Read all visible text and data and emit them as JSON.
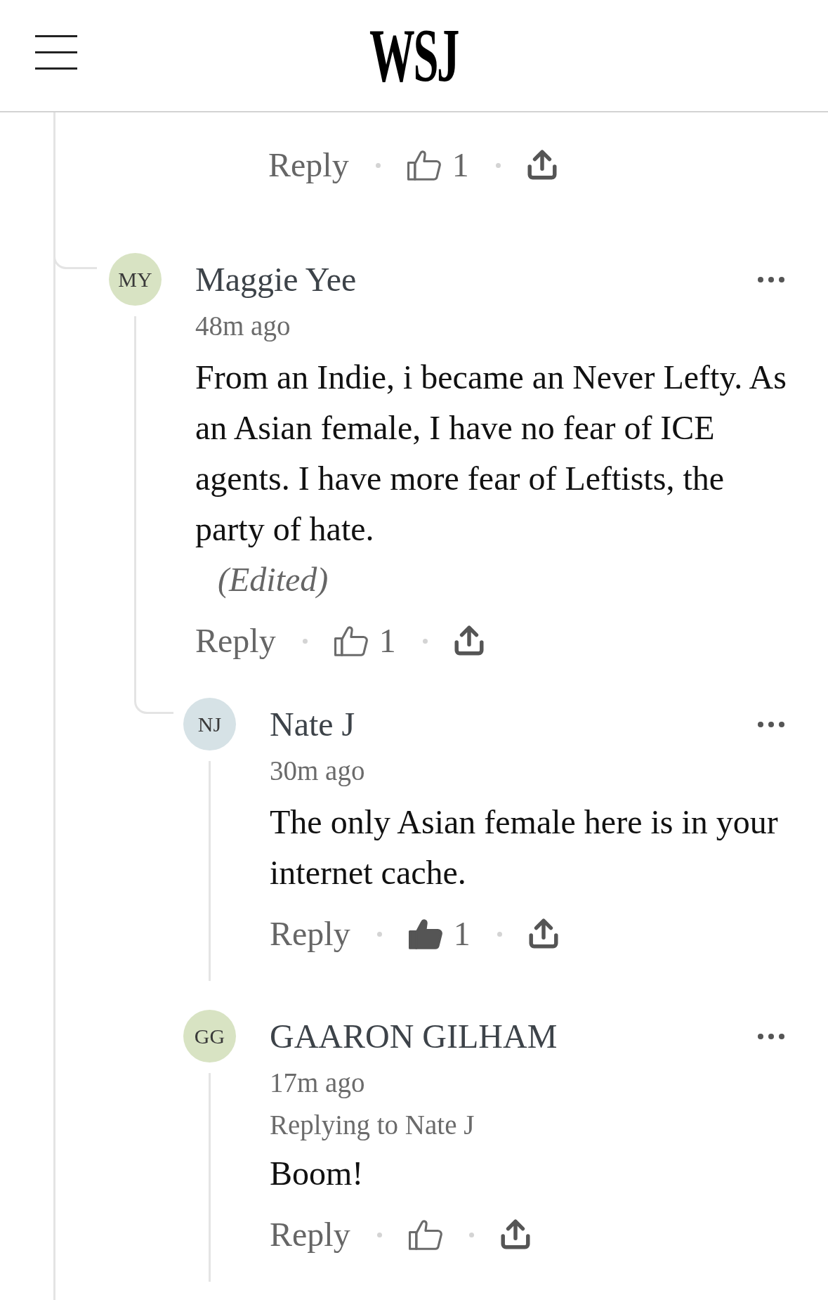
{
  "header": {
    "logo": "WSJ"
  },
  "thread": {
    "partial_comment": {
      "actions": {
        "reply": "Reply",
        "liked": false,
        "like_count": "1"
      }
    },
    "comments": [
      {
        "initials": "MY",
        "color": "#d8e3c3",
        "name": "Maggie Yee",
        "time": "48m ago",
        "connected": true,
        "body": "From an Indie, i became an Never Lefty. As an Asian female, I have no fear of ICE agents. I have more fear of Leftists, the party of hate.",
        "edited": "(Edited)",
        "actions": {
          "reply": "Reply",
          "liked": false,
          "like_count": "1"
        },
        "children": [
          {
            "initials": "NJ",
            "color": "#d6e2e6",
            "name": "Nate J",
            "time": "30m ago",
            "connected": true,
            "body": "The only Asian female here is in your internet cache.",
            "actions": {
              "reply": "Reply",
              "liked": true,
              "like_count": "1"
            }
          },
          {
            "initials": "GG",
            "color": "#d8e3c3",
            "name": "GAARON GILHAM",
            "time": "17m ago",
            "connected": false,
            "replying_to": "Replying to Nate J",
            "body": "Boom!",
            "actions": {
              "reply": "Reply",
              "liked": false
            }
          }
        ]
      }
    ]
  }
}
